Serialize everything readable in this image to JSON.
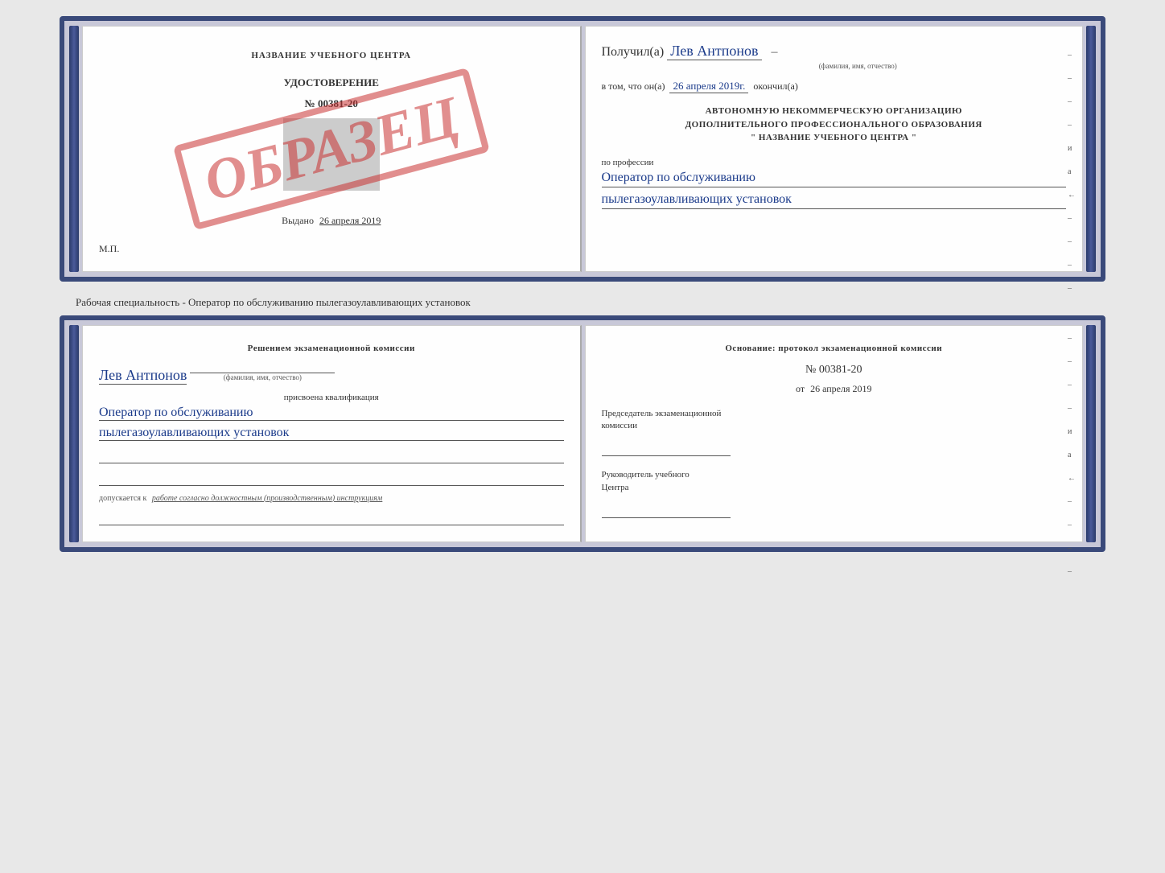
{
  "topBook": {
    "leftPage": {
      "title": "НАЗВАНИЕ УЧЕБНОГО ЦЕНТРА",
      "udostoverenie_label": "УДОСТОВЕРЕНИЕ",
      "number": "№ 00381-20",
      "vydano_prefix": "Выдано",
      "vydano_date": "26 апреля 2019",
      "mp": "М.П.",
      "obrazets": "ОБРАЗЕЦ"
    },
    "rightPage": {
      "poluchil_prefix": "Получил(а)",
      "name": "Лев Антпонов",
      "fio_hint": "(фамилия, имя, отчество)",
      "vtom_prefix": "в том, что он(а)",
      "date": "26 апреля 2019г.",
      "okonchil": "окончил(а)",
      "org_line1": "АВТОНОМНУЮ НЕКОММЕРЧЕСКУЮ ОРГАНИЗАЦИЮ",
      "org_line2": "ДОПОЛНИТЕЛЬНОГО ПРОФЕССИОНАЛЬНОГО ОБРАЗОВАНИЯ",
      "org_line3": "\"  НАЗВАНИЕ УЧЕБНОГО ЦЕНТРА  \"",
      "po_professii": "по профессии",
      "profession_line1": "Оператор по обслуживанию",
      "profession_line2": "пылегазоулавливающих установок",
      "dashes": [
        "–",
        "–",
        "–",
        "–",
        "и",
        "а",
        "←",
        "–",
        "–",
        "–",
        "–"
      ]
    }
  },
  "middleLabel": "Рабочая специальность - Оператор по обслуживанию пылегазоулавливающих установок",
  "bottomBook": {
    "leftPage": {
      "resheniyem": "Решением экзаменационной комиссии",
      "name": "Лев Антпонов",
      "fio_hint": "(фамилия, имя, отчество)",
      "prisvoena": "присвоена квалификация",
      "qualification_line1": "Оператор по обслуживанию",
      "qualification_line2": "пылегазоулавливающих установок",
      "dopusk_prefix": "допускается к",
      "dopusk_text": "работе согласно должностным (производственным) инструкциям"
    },
    "rightPage": {
      "osnovanie": "Основание: протокол экзаменационной комиссии",
      "number": "№  00381-20",
      "ot_prefix": "от",
      "date": "26 апреля 2019",
      "predsedatel_line1": "Председатель экзаменационной",
      "predsedatel_line2": "комиссии",
      "rukovoditel_line1": "Руководитель учебного",
      "rukovoditel_line2": "Центра",
      "dashes": [
        "–",
        "–",
        "–",
        "–",
        "и",
        "а",
        "←",
        "–",
        "–",
        "–",
        "–"
      ]
    }
  }
}
